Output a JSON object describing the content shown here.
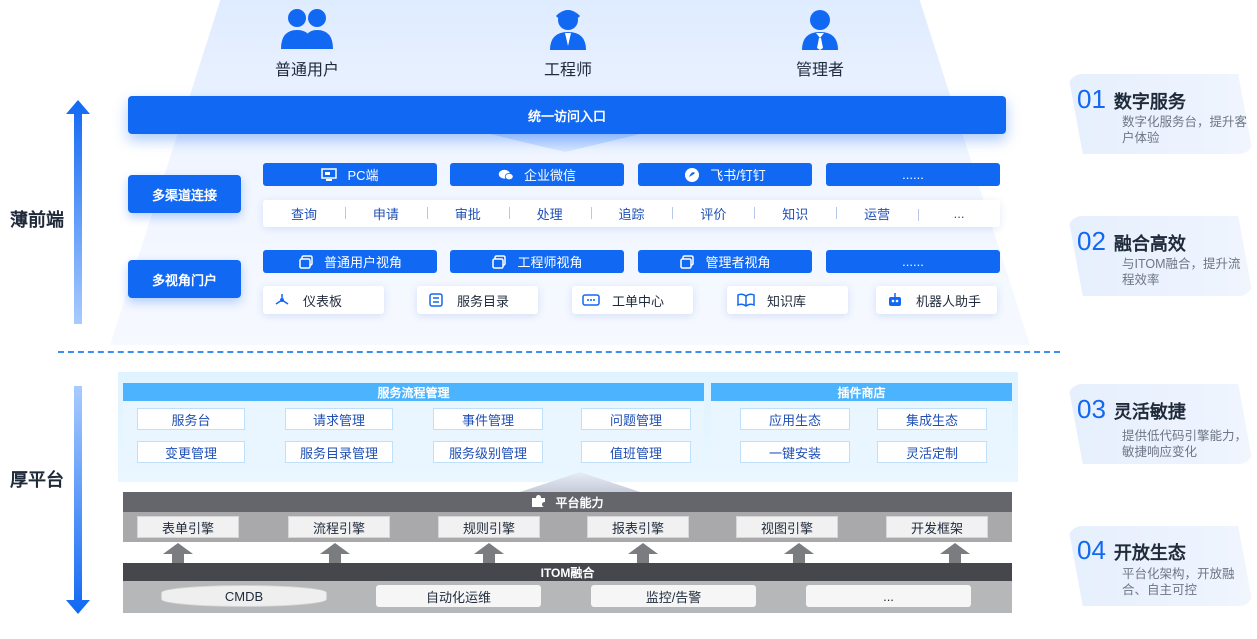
{
  "personas": [
    {
      "label": "普通用户",
      "icon": "users-icon"
    },
    {
      "label": "工程师",
      "icon": "engineer-icon"
    },
    {
      "label": "管理者",
      "icon": "manager-icon"
    }
  ],
  "side_labels": {
    "thin_front": "薄前端",
    "thick_platform": "厚平台"
  },
  "entry": "统一访问入口",
  "multi_channel": {
    "label": "多渠道连接",
    "channels": [
      {
        "label": "PC端",
        "icon": "pc-icon"
      },
      {
        "label": "企业微信",
        "icon": "wecom-icon"
      },
      {
        "label": "飞书/钉钉",
        "icon": "feishu-icon"
      },
      {
        "label": "......",
        "icon": ""
      }
    ],
    "functions": [
      "查询",
      "申请",
      "审批",
      "处理",
      "追踪",
      "评价",
      "知识",
      "运营",
      "..."
    ]
  },
  "multi_view": {
    "label": "多视角门户",
    "views": [
      {
        "label": "普通用户视角",
        "icon": "window-icon"
      },
      {
        "label": "工程师视角",
        "icon": "window-icon"
      },
      {
        "label": "管理者视角",
        "icon": "window-icon"
      },
      {
        "label": "......",
        "icon": ""
      }
    ],
    "cards": [
      {
        "label": "仪表板",
        "icon": "dashboard-icon"
      },
      {
        "label": "服务目录",
        "icon": "catalog-icon"
      },
      {
        "label": "工单中心",
        "icon": "ticket-icon"
      },
      {
        "label": "知识库",
        "icon": "book-icon"
      },
      {
        "label": "机器人助手",
        "icon": "robot-icon"
      }
    ]
  },
  "service_flow": {
    "title": "服务流程管理",
    "row1": [
      "服务台",
      "请求管理",
      "事件管理",
      "问题管理"
    ],
    "row2": [
      "变更管理",
      "服务目录管理",
      "服务级别管理",
      "值班管理"
    ]
  },
  "plugin_store": {
    "title": "插件商店",
    "row1": [
      "应用生态",
      "集成生态"
    ],
    "row2": [
      "一键安装",
      "灵活定制"
    ]
  },
  "platform": {
    "title": "平台能力",
    "engines": [
      "表单引擎",
      "流程引擎",
      "规则引擎",
      "报表引擎",
      "视图引擎",
      "开发框架"
    ]
  },
  "itom": {
    "title": "ITOM融合",
    "items": [
      "CMDB",
      "自动化运维",
      "监控/告警",
      "..."
    ]
  },
  "features": [
    {
      "num": "01",
      "name": "数字服务",
      "desc": "数字化服务台，提升客户体验"
    },
    {
      "num": "02",
      "name": "融合高效",
      "desc": "与ITOM融合，提升流程效率"
    },
    {
      "num": "03",
      "name": "灵活敏捷",
      "desc": "提供低代码引擎能力，敏捷响应变化"
    },
    {
      "num": "04",
      "name": "开放生态",
      "desc": "平台化架构，开放融合、自主可控"
    }
  ],
  "colors": {
    "primary": "#1168f3",
    "light_blue": "#4cb4ff",
    "dark_gray": "#45474c",
    "gray": "#65666c"
  }
}
